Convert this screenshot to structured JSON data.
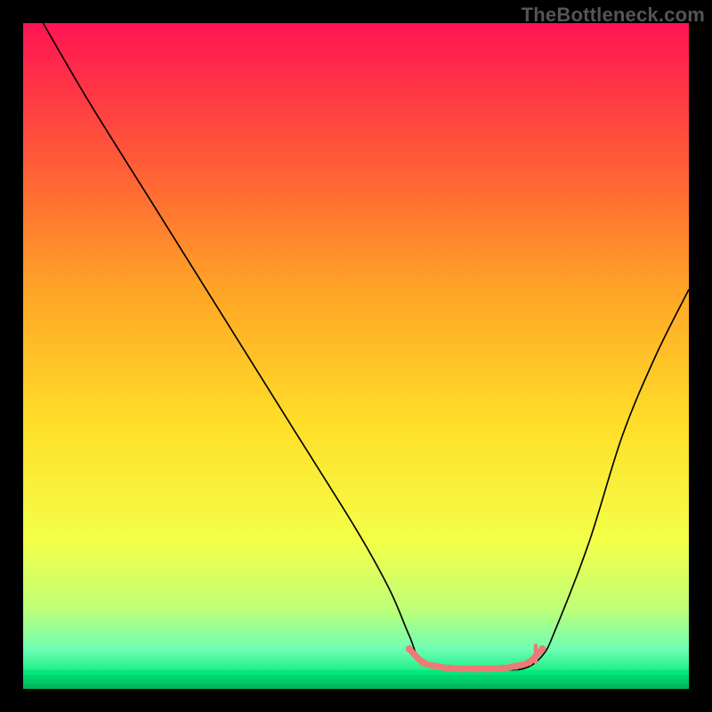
{
  "watermark": "TheBottleneck.com",
  "chart_data": {
    "type": "line",
    "title": "",
    "xlabel": "",
    "ylabel": "",
    "xlim": [
      0,
      100
    ],
    "ylim": [
      0,
      100
    ],
    "grid": false,
    "annotations": [],
    "series": [
      {
        "name": "curve",
        "color": "#000000",
        "x": [
          3,
          10,
          20,
          30,
          40,
          50,
          55,
          58,
          60,
          65,
          70,
          75,
          78,
          80,
          85,
          90,
          95,
          100
        ],
        "y": [
          100,
          88,
          72,
          56,
          40,
          24,
          15,
          8,
          4,
          3,
          3,
          3,
          5,
          9,
          22,
          38,
          50,
          60
        ]
      },
      {
        "name": "highlight",
        "color": "#ed7a75",
        "x": [
          58,
          60,
          62,
          64,
          66,
          68,
          70,
          72,
          74,
          76,
          78
        ],
        "y": [
          6,
          4,
          3.4,
          3.1,
          3,
          3,
          3,
          3.1,
          3.4,
          4,
          6
        ]
      }
    ],
    "gradient_stops": [
      {
        "offset": 0.0,
        "color": "#ff1453"
      },
      {
        "offset": 0.2,
        "color": "#ff5838"
      },
      {
        "offset": 0.4,
        "color": "#ffa426"
      },
      {
        "offset": 0.6,
        "color": "#ffde28"
      },
      {
        "offset": 0.78,
        "color": "#f3ff49"
      },
      {
        "offset": 0.88,
        "color": "#beff78"
      },
      {
        "offset": 0.94,
        "color": "#6fffb4"
      },
      {
        "offset": 0.985,
        "color": "#00e878"
      },
      {
        "offset": 1.0,
        "color": "#00c864"
      }
    ],
    "bottom_stripes": [
      {
        "y": 97.2,
        "h": 0.7,
        "color": "#00e878"
      },
      {
        "y": 97.9,
        "h": 0.7,
        "color": "#00d470"
      },
      {
        "y": 98.6,
        "h": 0.7,
        "color": "#00c864"
      },
      {
        "y": 99.3,
        "h": 0.7,
        "color": "#00b85a"
      }
    ],
    "tick_artifact": {
      "x": 77,
      "color": "#ed7a75"
    }
  }
}
